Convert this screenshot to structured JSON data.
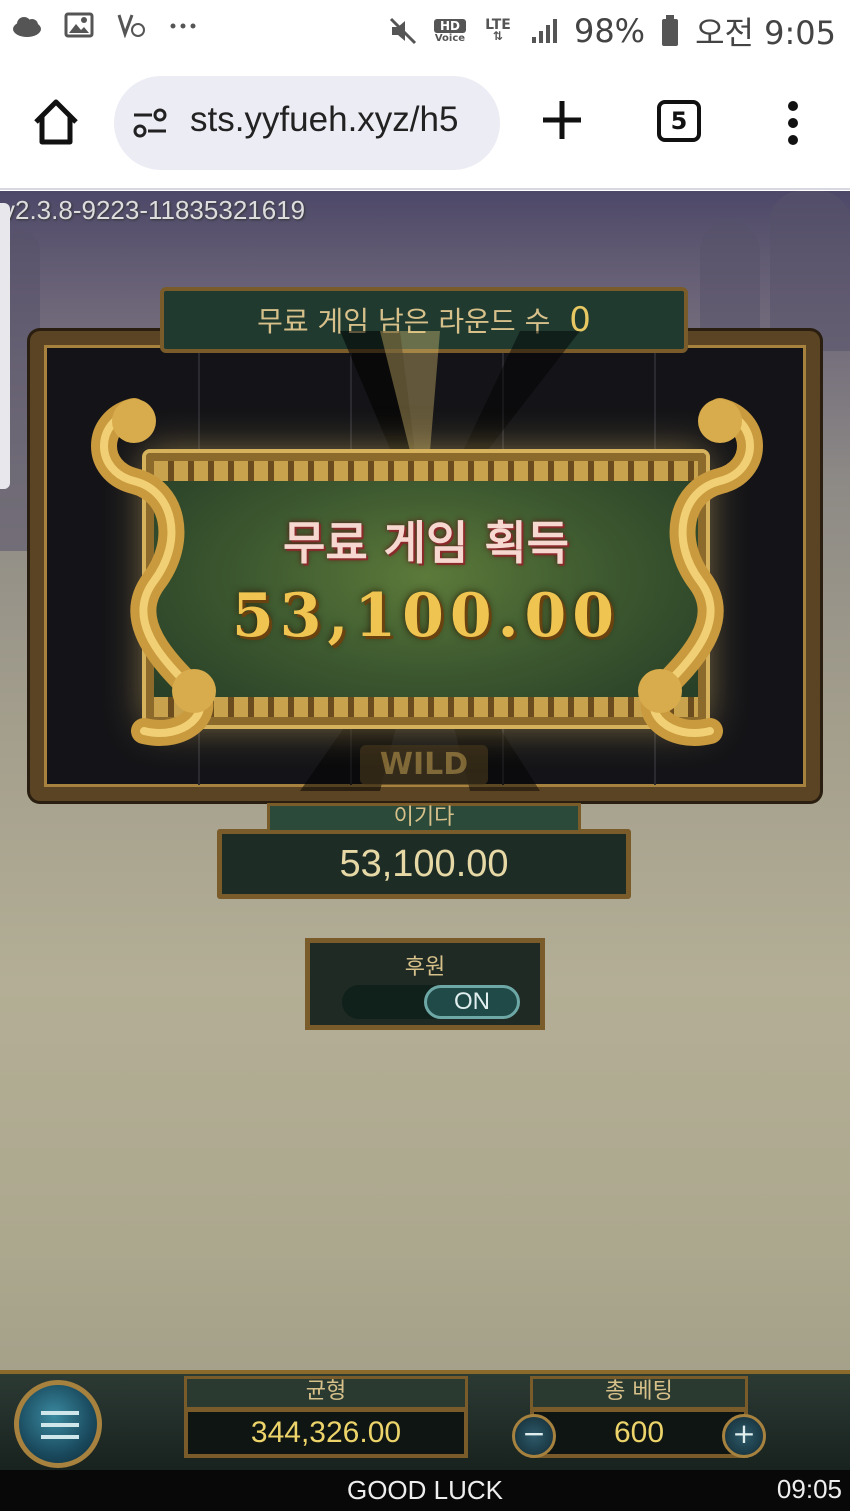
{
  "status_bar": {
    "battery": "98%",
    "clock": "오전 9:05",
    "hd_label": "HD",
    "voice_label": "Voice",
    "lte_label": "LTE"
  },
  "browser": {
    "url": "sts.yyfueh.xyz/h5",
    "tab_count": "5"
  },
  "game": {
    "version": "v2.3.8-9223-11835321619",
    "free_rounds_label": "무료 게임 남은 라운드 수",
    "free_rounds_count": "0",
    "popup_title": "무료 게임 획득",
    "popup_amount": "53,100.00",
    "wild_label": "WILD",
    "win_label": "이기다",
    "win_value": "53,100.00",
    "support_label": "후원",
    "support_toggle": "ON",
    "balance_label": "균형",
    "balance_value": "344,326.00",
    "bet_label": "총 베팅",
    "bet_value": "600",
    "bet_minus": "−",
    "bet_plus": "+",
    "footer_message": "GOOD LUCK",
    "footer_time": "09:05"
  },
  "colors": {
    "gold": "#f0c451",
    "frame": "#7a5b2a",
    "panel_green": "#3e5a30"
  }
}
